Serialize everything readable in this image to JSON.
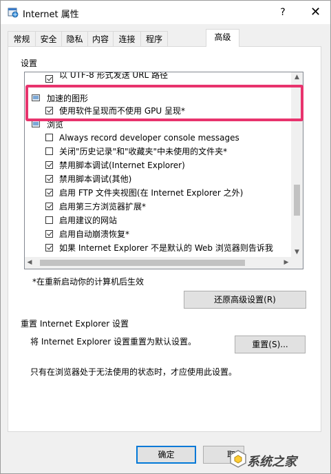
{
  "window": {
    "title": "Internet 属性",
    "help": "?",
    "close": "✕"
  },
  "tabs": [
    {
      "label": "常规"
    },
    {
      "label": "安全"
    },
    {
      "label": "隐私"
    },
    {
      "label": "内容"
    },
    {
      "label": "连接"
    },
    {
      "label": "程序"
    },
    {
      "label": "高级"
    }
  ],
  "active_tab": "高级",
  "settings": {
    "group_label": "设置",
    "items": [
      {
        "text": "以 UTF-8 形式发送 URL 路径",
        "type": "checkbox",
        "checked": true
      },
      {
        "text": "加速的图形",
        "type": "category"
      },
      {
        "text": "使用软件呈现而不使用 GPU 呈现*",
        "type": "checkbox",
        "checked": true
      },
      {
        "text": "浏览",
        "type": "category"
      },
      {
        "text": "Always record developer console messages",
        "type": "checkbox",
        "checked": false
      },
      {
        "text": "关闭\"历史记录\"和\"收藏夹\"中未使用的文件夹*",
        "type": "checkbox",
        "checked": false
      },
      {
        "text": "禁用脚本调试(Internet Explorer)",
        "type": "checkbox",
        "checked": true
      },
      {
        "text": "禁用脚本调试(其他)",
        "type": "checkbox",
        "checked": true
      },
      {
        "text": "启用 FTP 文件夹视图(在 Internet Explorer 之外)",
        "type": "checkbox",
        "checked": true
      },
      {
        "text": "启用第三方浏览器扩展*",
        "type": "checkbox",
        "checked": true
      },
      {
        "text": "启用建议的网站",
        "type": "checkbox",
        "checked": false
      },
      {
        "text": "启用自动崩溃恢复*",
        "type": "checkbox",
        "checked": true
      },
      {
        "text": "如果 Internet Explorer 不是默认的 Web 浏览器则告诉我",
        "type": "checkbox",
        "checked": true
      }
    ],
    "restart_note": "*在重新启动你的计算机后生效",
    "restore_button": "还原高级设置(R)"
  },
  "reset": {
    "group_label": "重置 Internet Explorer 设置",
    "description": "将 Internet Explorer 设置重置为默认设置。",
    "button": "重置(S)...",
    "warning": "只有在浏览器处于无法使用的状态时，才应使用此设置。"
  },
  "footer": {
    "ok": "确定",
    "cancel": "取"
  },
  "watermark": {
    "text": "系统之家"
  },
  "colors": {
    "highlight": "#e8336d",
    "focus": "#0078d7"
  }
}
